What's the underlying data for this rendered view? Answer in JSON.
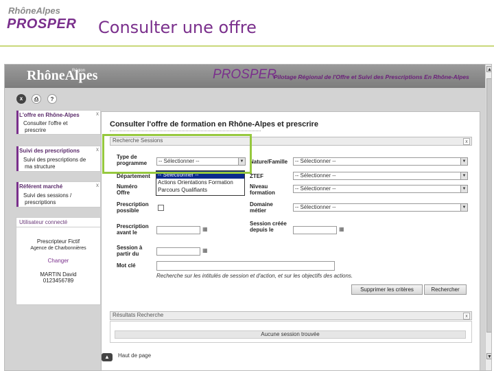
{
  "slide": {
    "logo_top": "RhôneAlpes",
    "logo_bottom": "PROSPER",
    "title": "Consulter une offre"
  },
  "app": {
    "logo": "RhôneAlpes",
    "logo_sup": "Région",
    "prosper": "PROSPER",
    "prosper_subtitle": "Pilotage Régional de l'Offre et Suivi des Prescriptions En Rhône-Alpes"
  },
  "toolbar": {
    "close": "x",
    "print": "⎙",
    "help": "?"
  },
  "sidebar": {
    "offer": {
      "title": "L'offre en Rhône-Alpes",
      "links": [
        "Consulter l'offre et",
        "prescrire"
      ]
    },
    "prescriptions": {
      "title": "Suivi des prescriptions",
      "links": [
        "Suivi des prescriptions de",
        "ma structure"
      ]
    },
    "market": {
      "title": "Référent marché",
      "links": [
        "Suivi des sessions /",
        "prescriptions"
      ]
    },
    "user": {
      "title": "Utilisateur connecté",
      "name": "Prescripteur Fictif",
      "agency": "Agence de Charbonnières",
      "change": "Changer",
      "person": "MARTIN David",
      "phone": "0123456789"
    },
    "close_glyph": "x"
  },
  "main": {
    "title": "Consulter l'offre de formation en Rhône-Alpes et prescrire",
    "search_panel": "Recherche Sessions",
    "results_panel": "Résultats Recherche",
    "no_session": "Aucune session trouvée",
    "fields": {
      "type_programme": "Type de programme",
      "departement": "Département",
      "numero_offre": "Numéro Offre",
      "prescription": "Prescription possible",
      "prescription_avant": "Prescription avant le",
      "session_partir": "Session à partir du",
      "mot_cle": "Mot clé",
      "nature_famille": "Nature/Famille",
      "ztef": "ZTEF",
      "niveau": "Niveau formation",
      "domaine": "Domaine métier",
      "session_creee": "Session créée depuis le"
    },
    "select_default": "-- Sélectionner --",
    "dropdown_options": [
      "-- Sélectionner --",
      "Actions Orientations Formation",
      "Parcours Qualifiants"
    ],
    "hint": "Recherche sur les intitulés de session et d'action, et sur les objectifs des actions.",
    "btn_clear": "Supprimer les critères",
    "btn_search": "Rechercher",
    "footer_link": "Haut de page"
  },
  "colors": {
    "brand_purple": "#7a2f8c",
    "highlight_green": "#96c83e"
  }
}
